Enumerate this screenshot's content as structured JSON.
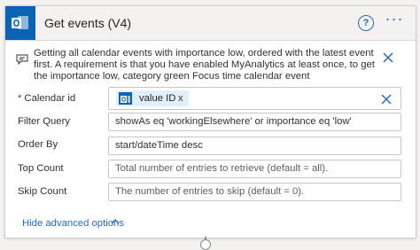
{
  "header": {
    "title": "Get events (V4)",
    "icon": "outlook-icon",
    "help_label": "?",
    "more_label": "···",
    "accent": "#0a63b4",
    "link_color": "#2b6bbf"
  },
  "description": {
    "text": "Getting all calendar events with importance low, ordered with the latest event first. A requirement is that you have enabled MyAnalytics at least once, to get the importance low, category green Focus time calendar event"
  },
  "fields": {
    "calendar_id": {
      "label": "Calendar id",
      "required_marker": "*",
      "token_label": "value ID",
      "token_remove": "x"
    },
    "filter_query": {
      "label": "Filter Query",
      "value": "showAs eq 'workingElsewhere' or importance eq 'low'"
    },
    "order_by": {
      "label": "Order By",
      "value": "start/dateTime desc"
    },
    "top_count": {
      "label": "Top Count",
      "placeholder": "Total number of entries to retrieve (default = all)."
    },
    "skip_count": {
      "label": "Skip Count",
      "placeholder": "The number of entries to skip (default = 0)."
    }
  },
  "advanced": {
    "label": "Hide advanced options"
  }
}
